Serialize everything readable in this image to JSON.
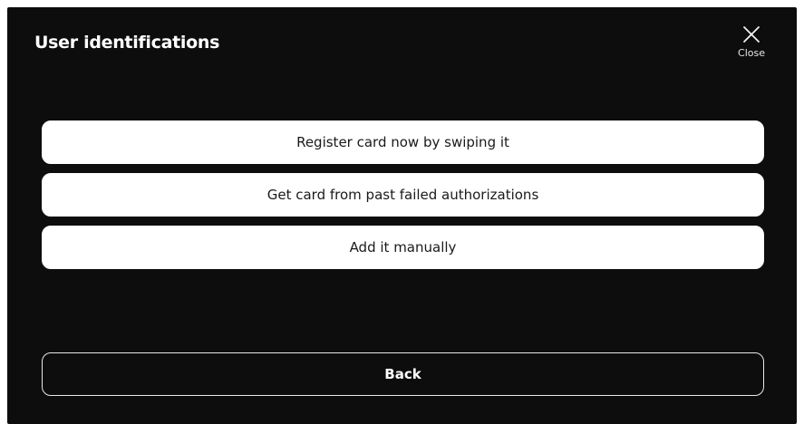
{
  "dialog": {
    "title": "User identifications",
    "close_label": "Close",
    "options": [
      {
        "label": "Register card now by swiping it"
      },
      {
        "label": "Get card from past failed authorizations"
      },
      {
        "label": "Add it manually"
      }
    ],
    "back_label": "Back"
  },
  "colors": {
    "background": "#0d0d0d",
    "button_fill": "#ffffff",
    "button_text": "#1a1a1a",
    "back_border": "#e9e9e9"
  },
  "icons": {
    "close": "close-icon"
  }
}
